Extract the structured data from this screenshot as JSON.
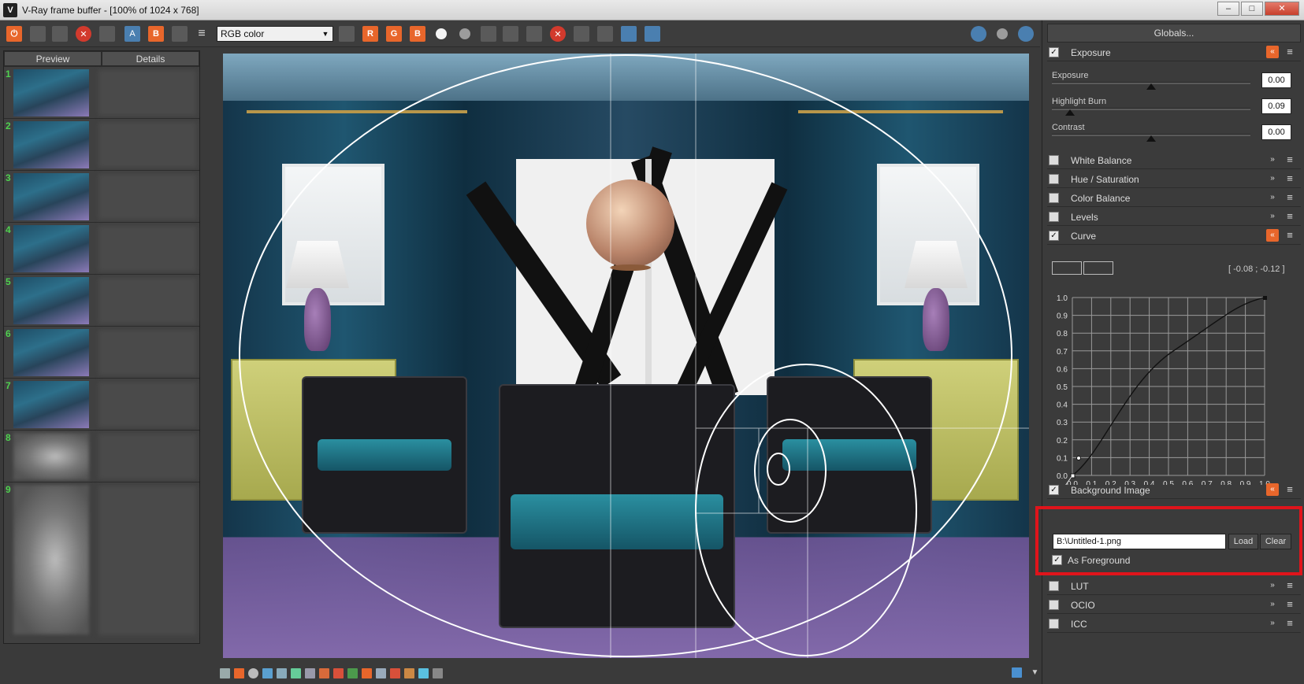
{
  "window": {
    "title": "V-Ray frame buffer - [100% of 1024 x 768]",
    "app_icon_glyph": "V",
    "controls": {
      "minimize": "–",
      "maximize": "□",
      "close": "✕"
    }
  },
  "toolbar": {
    "channel": "RGB color",
    "channel_arrow": "▼",
    "buttons": {
      "power": "⏻",
      "save": "💾",
      "clear": "✕",
      "a": "A",
      "b": "B",
      "r": "R",
      "g": "G",
      "b2": "B",
      "menu": "≡"
    }
  },
  "history": {
    "tabs": [
      "Preview",
      "Details"
    ],
    "items": [
      "1",
      "2",
      "3",
      "4",
      "5",
      "6",
      "7",
      "8",
      "9"
    ]
  },
  "right_panel": {
    "globals_label": "Globals...",
    "exposure": {
      "label": "Exposure",
      "sliders": [
        {
          "label": "Exposure",
          "value": "0.00",
          "position": 0.5
        },
        {
          "label": "Highlight Burn",
          "value": "0.09",
          "position": 0.09
        },
        {
          "label": "Contrast",
          "value": "0.00",
          "position": 0.5
        }
      ]
    },
    "sections": [
      {
        "label": "White Balance",
        "checked": false
      },
      {
        "label": "Hue / Saturation",
        "checked": false
      },
      {
        "label": "Color Balance",
        "checked": false
      },
      {
        "label": "Levels",
        "checked": false
      },
      {
        "label": "Curve",
        "checked": true
      }
    ],
    "curve": {
      "coords": "[ -0.08 ; -0.12 ]",
      "y_ticks": [
        "1.0",
        "0.9",
        "0.8",
        "0.7",
        "0.6",
        "0.5",
        "0.4",
        "0.3",
        "0.2",
        "0.1",
        "0.0"
      ],
      "x_ticks": [
        "0.0",
        "0.1",
        "0.2",
        "0.3",
        "0.4",
        "0.5",
        "0.6",
        "0.7",
        "0.8",
        "0.9",
        "1.0"
      ]
    },
    "background_image": {
      "label": "Background Image",
      "path": "B:\\Untitled-1.png",
      "load_label": "Load",
      "clear_label": "Clear",
      "as_foreground_label": "As Foreground",
      "as_foreground_checked": true
    },
    "bottom_sections": [
      {
        "label": "LUT",
        "checked": false
      },
      {
        "label": "OCIO",
        "checked": false
      },
      {
        "label": "ICC",
        "checked": false
      }
    ],
    "check_glyph": "✓",
    "expand_glyph": "»",
    "collapse_glyph": "«",
    "menu_glyph": "≡"
  },
  "colors": {
    "accent_orange": "#e8662b",
    "highlight_red": "#e0141b",
    "panel_bg": "#3b3b3b"
  }
}
